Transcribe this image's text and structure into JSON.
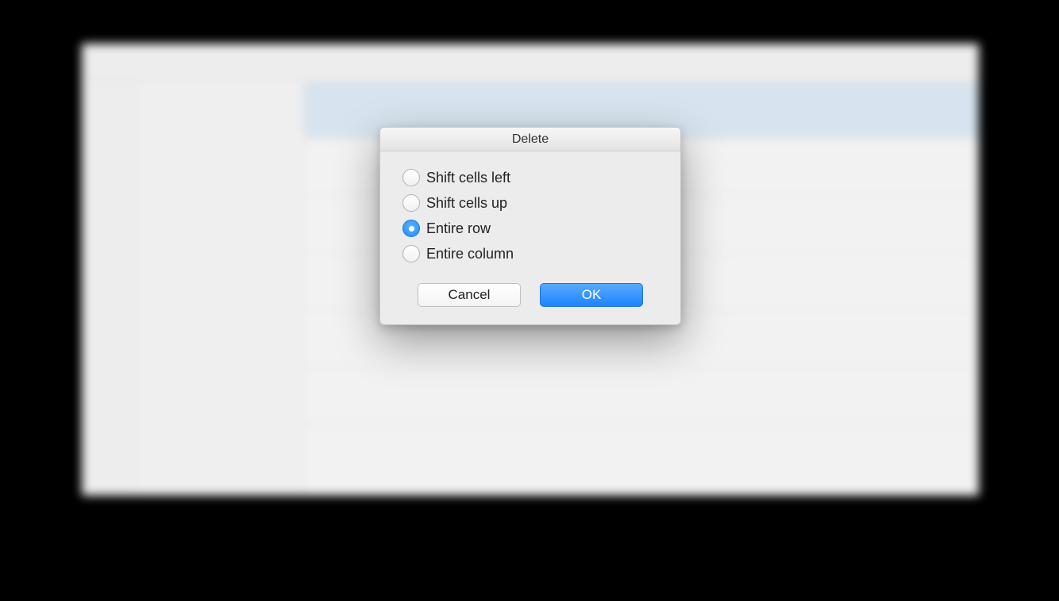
{
  "dialog": {
    "title": "Delete",
    "options": [
      {
        "label": "Shift cells left",
        "selected": false
      },
      {
        "label": "Shift cells up",
        "selected": false
      },
      {
        "label": "Entire row",
        "selected": true
      },
      {
        "label": "Entire column",
        "selected": false
      }
    ],
    "cancel_label": "Cancel",
    "ok_label": "OK"
  }
}
